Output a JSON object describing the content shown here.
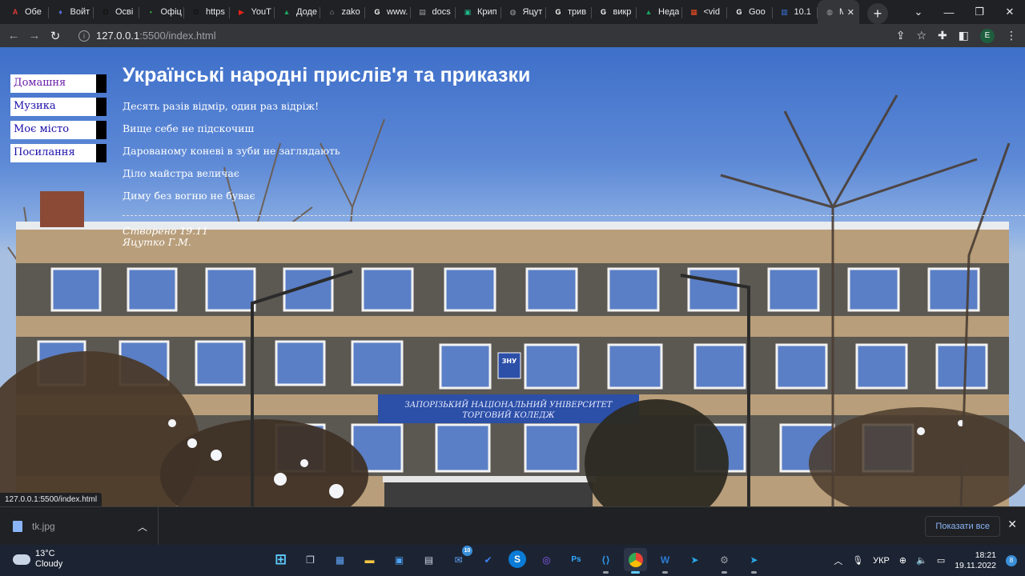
{
  "browser": {
    "tabs": [
      {
        "title": "Обе",
        "icon": "acrobat-icon",
        "color": "#e33a3a",
        "glyph": "A"
      },
      {
        "title": "Войт",
        "icon": "lightbulb-icon",
        "color": "#5b6bd9",
        "glyph": "♦"
      },
      {
        "title": "Осві",
        "icon": "dn-icon",
        "color": "#111111",
        "glyph": "D"
      },
      {
        "title": "Офіц",
        "icon": "ellipsis-icon",
        "color": "#2f9e44",
        "glyph": "•"
      },
      {
        "title": "https",
        "icon": "dn-icon",
        "color": "#111111",
        "glyph": "D"
      },
      {
        "title": "YouT",
        "icon": "youtube-icon",
        "color": "#e62117",
        "glyph": "▶"
      },
      {
        "title": "Доде",
        "icon": "drive-icon",
        "color": "#1aa260",
        "glyph": "▲"
      },
      {
        "title": "zako",
        "icon": "house-icon",
        "color": "#9aa0a6",
        "glyph": "⌂"
      },
      {
        "title": "www.",
        "icon": "google-icon",
        "color": "#ffffff",
        "glyph": "G"
      },
      {
        "title": "docs",
        "icon": "docs-icon",
        "color": "#9aa0a6",
        "glyph": "▤"
      },
      {
        "title": "Крип",
        "icon": "crypto-icon",
        "color": "#1fb98a",
        "glyph": "▣"
      },
      {
        "title": "Яцут",
        "icon": "globe-icon",
        "color": "#9aa0a6",
        "glyph": "◍"
      },
      {
        "title": "трив",
        "icon": "google-icon",
        "color": "#ffffff",
        "glyph": "G"
      },
      {
        "title": "викр",
        "icon": "google-icon",
        "color": "#ffffff",
        "glyph": "G"
      },
      {
        "title": "Неда",
        "icon": "drive-icon",
        "color": "#1aa260",
        "glyph": "▲"
      },
      {
        "title": "<vid",
        "icon": "microsoft-icon",
        "color": "#f25022",
        "glyph": "▦"
      },
      {
        "title": "Goo",
        "icon": "google-icon",
        "color": "#ffffff",
        "glyph": "G"
      },
      {
        "title": "10.1",
        "icon": "image-icon",
        "color": "#3b78e7",
        "glyph": "▥"
      },
      {
        "title": "М",
        "icon": "globe-icon",
        "color": "#9aa0a6",
        "glyph": "◍",
        "active": true
      }
    ],
    "url_host": "127.0.0.1",
    "url_rest": ":5500/index.html",
    "profile_initial": "E",
    "status_url": "127.0.0.1:5500/index.html"
  },
  "page": {
    "nav": [
      "Домашня",
      "Музика",
      "Моє місто",
      "Посилання"
    ],
    "title": "Українські народні прислів'я та приказки",
    "proverbs": [
      "Десять разів відмір, один раз відріж!",
      "Вище себе не підскочиш",
      "Дарованому коневі в зуби не заглядають",
      "Діло майстра величає",
      "Диму без вогню не буває"
    ],
    "footer_created": "Створено 19.11",
    "footer_author": "Яцутко Г.М.",
    "building_sign_line1": "ЗАПОРІЗЬКИЙ НАЦІОНАЛЬНИЙ УНІВЕРСИТЕТ",
    "building_sign_line2": "ТОРГОВИЙ КОЛЕДЖ",
    "building_logo": "ЗНУ"
  },
  "downloads": {
    "file": "tk.jpg",
    "show_all": "Показати все"
  },
  "taskbar": {
    "temp": "13°C",
    "weather": "Cloudy",
    "language": "УКР",
    "time": "18:21",
    "date": "19.11.2022",
    "notifications": "8",
    "mail_badge": "10"
  }
}
